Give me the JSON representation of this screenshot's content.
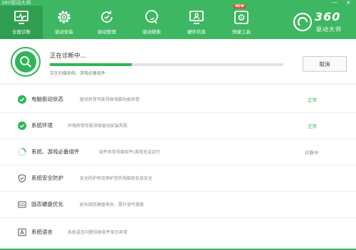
{
  "window": {
    "title": "360驱动大师",
    "minimize": "—",
    "close": "×"
  },
  "nav": [
    {
      "label": "全面诊断",
      "icon": "monitor-icon"
    },
    {
      "label": "驱动安装",
      "icon": "gear-icon"
    },
    {
      "label": "驱动管理",
      "icon": "refresh-icon"
    },
    {
      "label": "驱动搜索",
      "icon": "search-icon"
    },
    {
      "label": "硬件信息",
      "icon": "hardware-icon"
    },
    {
      "label": "快捷工具",
      "icon": "toolbox-icon",
      "badge": "NEW"
    }
  ],
  "logo": {
    "number": "360",
    "subtitle": "驱动大师"
  },
  "status": {
    "title": "正在诊断中...",
    "subtitle": "正在扫描系统、游戏必备组件",
    "progress": 0.35,
    "cancel_label": "取消"
  },
  "items": [
    {
      "title": "电脑驱动状态",
      "desc": "驱动异常可能导致电脑功能异常",
      "status": "正常",
      "state": "done"
    },
    {
      "title": "系统环境",
      "desc": "环境异常可能导致驱动安装失败",
      "status": "正常",
      "state": "done"
    },
    {
      "title": "系统、游戏必备组件",
      "desc": "组件异常导致软件/游戏无法运行",
      "status": "诊断中",
      "state": "scanning"
    },
    {
      "title": "系统安全防护",
      "desc": "安全防护有效保护您的电脑及信息安全",
      "status": "",
      "state": "pending",
      "icon": "shield-icon"
    },
    {
      "title": "固态硬盘优化",
      "desc": "延长固态硬盘寿命，提升读写速度",
      "status": "",
      "state": "pending",
      "icon": "ssd-icon"
    },
    {
      "title": "系统语言",
      "desc": "系统语言问题导致软件显示异常",
      "status": "",
      "state": "pending",
      "icon": "language-icon"
    }
  ],
  "colors": {
    "brand": "#3eb762",
    "active_nav": "#2f9e50",
    "ok": "#2fb559"
  }
}
